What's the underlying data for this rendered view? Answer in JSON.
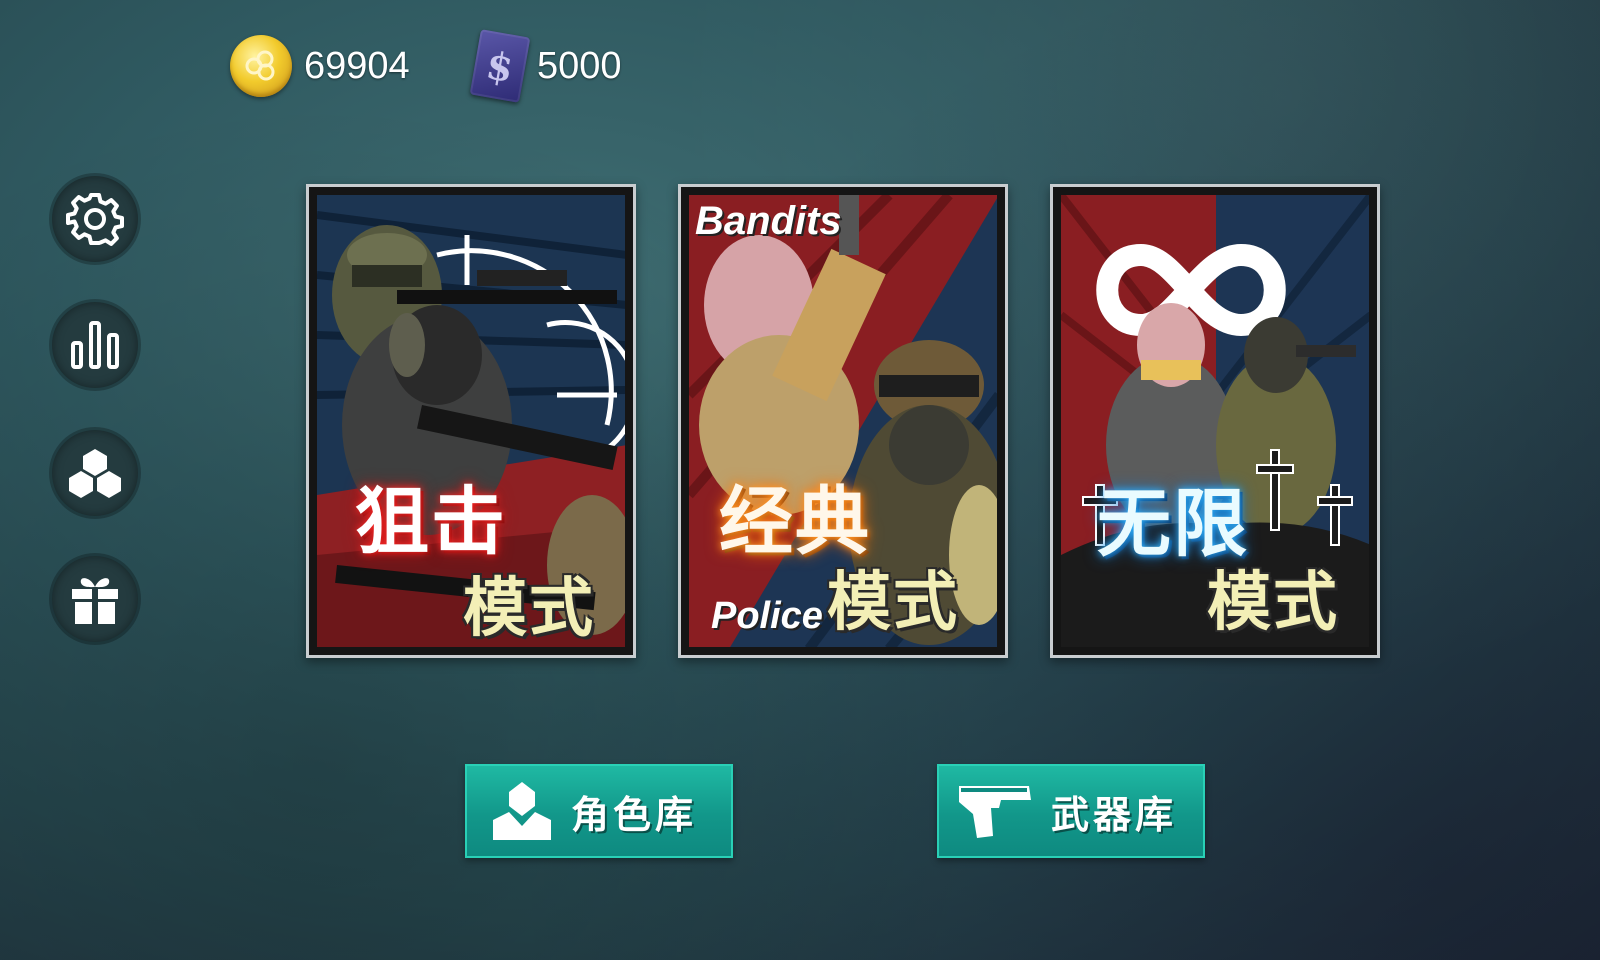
{
  "currency": {
    "coins": {
      "icon": "coin-icon",
      "value": "69904"
    },
    "cash": {
      "icon": "cash-icon",
      "symbol": "$",
      "value": "5000"
    }
  },
  "side_menu": [
    {
      "id": "settings",
      "icon": "gear-icon"
    },
    {
      "id": "stats",
      "icon": "bar-chart-icon"
    },
    {
      "id": "inventory",
      "icon": "crates-icon"
    },
    {
      "id": "gifts",
      "icon": "gift-icon"
    }
  ],
  "modes": [
    {
      "id": "sniper",
      "title": "狙击",
      "subtitle": "模式"
    },
    {
      "id": "classic",
      "title": "经典",
      "subtitle": "模式",
      "logo_top": "Bandits",
      "logo_bottom": "Police"
    },
    {
      "id": "endless",
      "title": "无限",
      "subtitle": "模式"
    }
  ],
  "buttons": {
    "characters": {
      "label": "角色库",
      "icon": "character-icon"
    },
    "weapons": {
      "label": "武器库",
      "icon": "pistol-icon"
    }
  }
}
